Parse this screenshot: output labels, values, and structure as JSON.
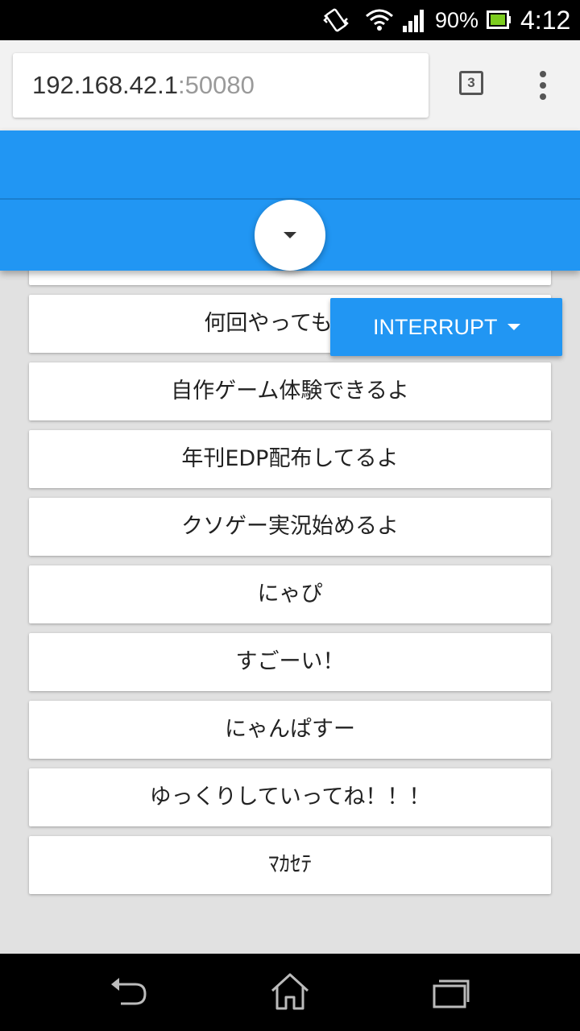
{
  "status_bar": {
    "battery_percent": "90%",
    "time": "4:12",
    "icons": [
      "vibrate-icon",
      "wifi-icon",
      "signal-icon",
      "battery-icon"
    ]
  },
  "browser": {
    "url_host": "192.168.42.1",
    "url_port": ":50080",
    "tab_count": "3",
    "icons": [
      "tab-switcher-icon",
      "overflow-menu-icon"
    ]
  },
  "header": {
    "toggle_icon": "caret-down-icon",
    "colors": {
      "primary": "#2196f3",
      "background": "#e1e1e1"
    }
  },
  "list": {
    "items": [
      "何回やっても何回",
      "自作ゲーム体験できるよ",
      "年刊EDP配布してるよ",
      "クソゲー実況始めるよ",
      "にゃぴ",
      "すごーい！",
      "にゃんぱすー",
      "ゆっくりしていってね！！！",
      "ﾏｶｾﾃ"
    ]
  },
  "interrupt_button": {
    "label": "INTERRUPT",
    "icon": "caret-down-icon"
  },
  "nav_bar": {
    "icons": [
      "back-icon",
      "home-icon",
      "recent-apps-icon"
    ]
  }
}
